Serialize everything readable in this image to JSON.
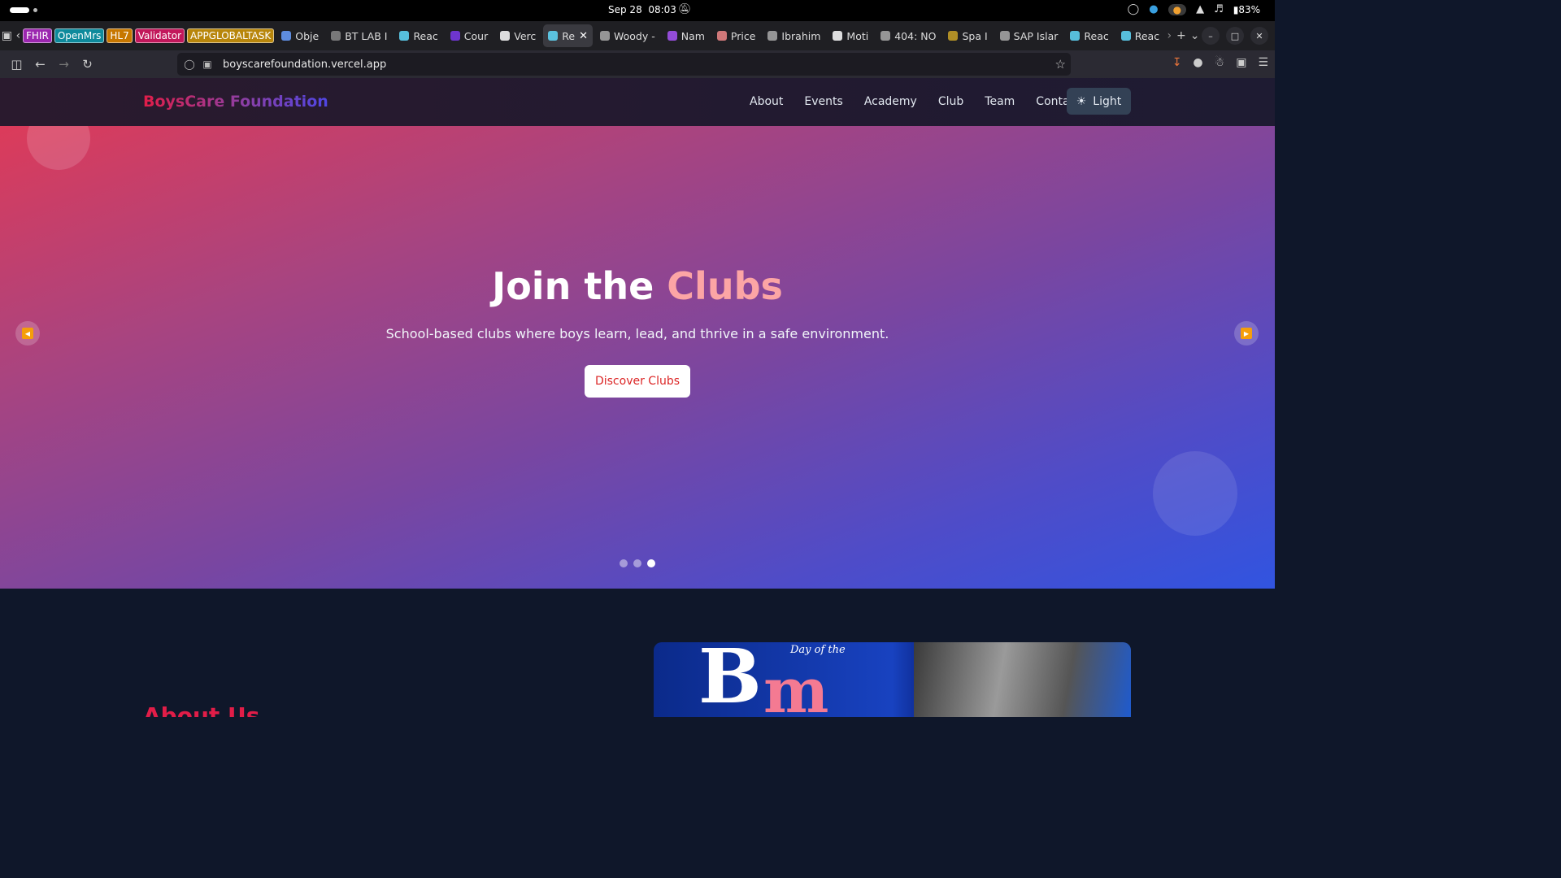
{
  "os": {
    "date": "Sep 28",
    "time": "08:03",
    "battery": "83%"
  },
  "tabs": [
    {
      "label": "FHIR",
      "type": "badge",
      "color": "#9b27af"
    },
    {
      "label": "OpenMrs",
      "type": "badge",
      "color": "#0e8a9c"
    },
    {
      "label": "HL7",
      "type": "badge",
      "color": "#c77700"
    },
    {
      "label": "Validator",
      "type": "badge",
      "color": "#c2185b"
    },
    {
      "label": "APPGLOBALTASK",
      "type": "badge",
      "color": "#b8860b"
    },
    {
      "label": "Obje",
      "type": "tab"
    },
    {
      "label": "BT LAB I",
      "type": "tab"
    },
    {
      "label": "Reac",
      "type": "tab"
    },
    {
      "label": "Cour",
      "type": "tab"
    },
    {
      "label": "Verc",
      "type": "tab"
    },
    {
      "label": "Re",
      "type": "tab",
      "active": true
    },
    {
      "label": "Woody -",
      "type": "tab"
    },
    {
      "label": "Nam",
      "type": "tab"
    },
    {
      "label": "Price",
      "type": "tab"
    },
    {
      "label": "Ibrahim",
      "type": "tab"
    },
    {
      "label": "Moti",
      "type": "tab"
    },
    {
      "label": "404: NO",
      "type": "tab"
    },
    {
      "label": "Spa I",
      "type": "tab"
    },
    {
      "label": "SAP Islar",
      "type": "tab"
    },
    {
      "label": "Reac",
      "type": "tab"
    },
    {
      "label": "Reac",
      "type": "tab"
    }
  ],
  "browser": {
    "url": "boyscarefoundation.vercel.app"
  },
  "site": {
    "brand": "BoysCare Foundation",
    "menu": [
      "About",
      "Events",
      "Academy",
      "Club",
      "Team",
      "Contact"
    ],
    "theme_toggle": "Light"
  },
  "hero": {
    "title_prefix": "Join the",
    "title_highlight": "Clubs",
    "subtitle": "School-based clubs where boys learn, lead, and thrive in a safe environment.",
    "cta": "Discover Clubs",
    "slide_count": 3,
    "active_slide": 3
  },
  "about": {
    "title": "About Us",
    "image_text_small": "Day of the",
    "image_text_big": "B"
  },
  "colors": {
    "accent": "#e11d48",
    "highlight": "#fca5a5",
    "header_bg": "#241b30",
    "page_bg": "#0f172a"
  }
}
